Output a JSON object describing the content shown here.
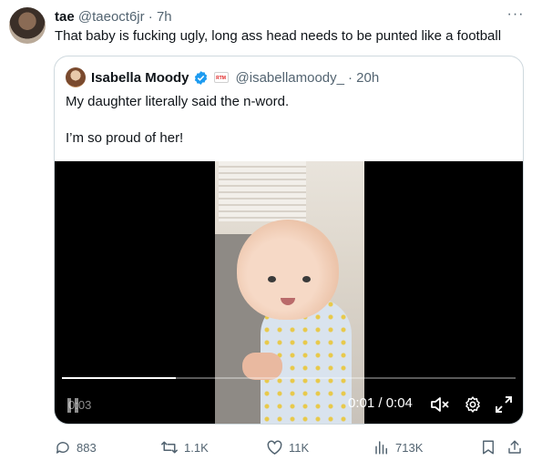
{
  "tweet": {
    "author_name": "tae",
    "author_handle": "@taeoct6jr",
    "time": "· 7h",
    "more": "···",
    "text": "That baby is fucking ugly, long ass head needs to be punted like a football"
  },
  "quoted": {
    "author_name": "Isabella Moody",
    "author_handle": "@isabellamoody_",
    "time": "· 20h",
    "badge": "RTM",
    "text_lines": [
      "My daughter literally said the n-word.",
      "I’m so proud of her!"
    ],
    "video": {
      "overlay_time": "0:03",
      "time_label": "0:01 / 0:04",
      "progress": 0.25
    }
  },
  "actions": {
    "replies": "883",
    "reposts": "1.1K",
    "likes": "11K",
    "views": "713K"
  },
  "colors": {
    "verified": "#1d9bf0",
    "muted_text": "#536471",
    "border": "#cfd9de"
  }
}
